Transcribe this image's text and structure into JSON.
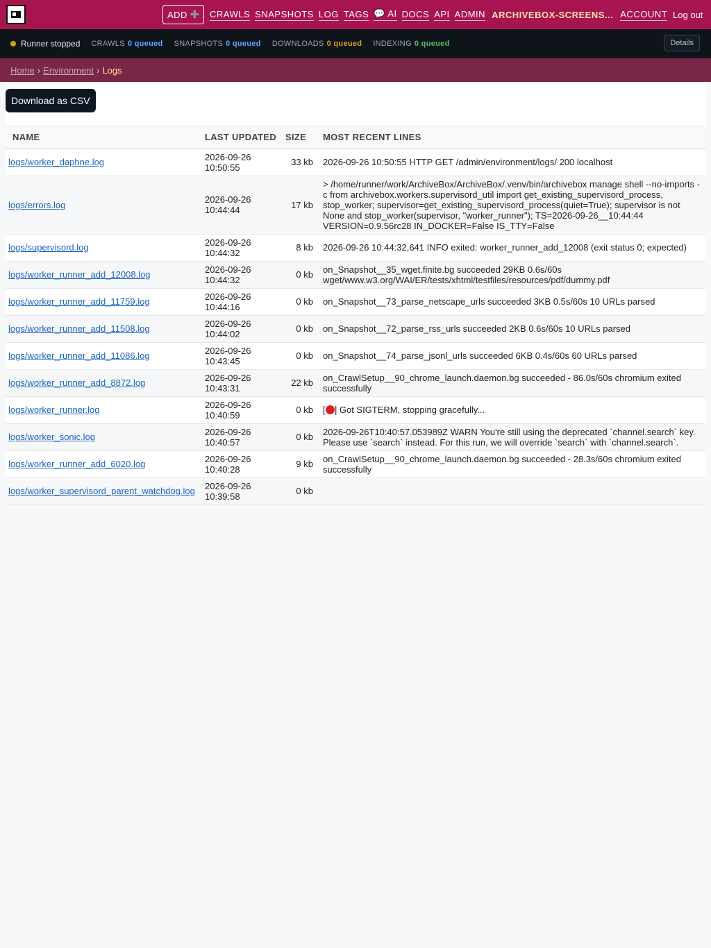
{
  "header": {
    "add_label": "ADD",
    "nav": [
      "CRAWLS",
      "SNAPSHOTS",
      "LOG",
      "TAGS",
      "💬 AI",
      "DOCS",
      "API",
      "ADMIN"
    ],
    "user": "ARCHIVEBOX-SCREENS...",
    "account": "ACCOUNT",
    "logout": "Log out"
  },
  "status": {
    "runner": "Runner stopped",
    "crawls_label": "CRAWLS",
    "crawls_q": "0 queued",
    "snapshots_label": "SNAPSHOTS",
    "snapshots_q": "0 queued",
    "downloads_label": "DOWNLOADS",
    "downloads_q": "0 queued",
    "indexing_label": "INDEXING",
    "indexing_q": "0 queued",
    "details": "Details"
  },
  "breadcrumb": {
    "home": "Home",
    "environment": "Environment",
    "sep": "›",
    "current": "Logs"
  },
  "main": {
    "csv_button": "Download as CSV",
    "columns": [
      "NAME",
      "LAST UPDATED",
      "SIZE",
      "MOST RECENT LINES"
    ],
    "rows": [
      {
        "name": "logs/worker_daphne.log",
        "date": "2026-09-26",
        "time": "10:50:55",
        "size": "33 kb",
        "lines": "2026-09-26 10:50:55 HTTP GET /admin/environment/logs/ 200 localhost"
      },
      {
        "name": "logs/errors.log",
        "date": "2026-09-26",
        "time": "10:44:44",
        "size": "17 kb",
        "lines": "> /home/runner/work/ArchiveBox/ArchiveBox/.venv/bin/archivebox manage shell --no-imports -c from archivebox.workers.supervisord_util import get_existing_supervisord_process, stop_worker; supervisor=get_existing_supervisord_process(quiet=True); supervisor is not None and stop_worker(supervisor, \"worker_runner\"); TS=2026-09-26__10:44:44 VERSION=0.9.56rc28 IN_DOCKER=False IS_TTY=False"
      },
      {
        "name": "logs/supervisord.log",
        "date": "2026-09-26",
        "time": "10:44:32",
        "size": "8 kb",
        "lines": "2026-09-26 10:44:32,641 INFO exited: worker_runner_add_12008 (exit status 0; expected)"
      },
      {
        "name": "logs/worker_runner_add_12008.log",
        "date": "2026-09-26",
        "time": "10:44:32",
        "size": "0 kb",
        "lines": "on_Snapshot__35_wget.finite.bg succeeded 29KB 0.6s/60s wget/www.w3.org/WAI/ER/tests/xhtml/testfiles/resources/pdf/dummy.pdf"
      },
      {
        "name": "logs/worker_runner_add_11759.log",
        "date": "2026-09-26",
        "time": "10:44:16",
        "size": "0 kb",
        "lines": "on_Snapshot__73_parse_netscape_urls succeeded 3KB 0.5s/60s 10 URLs parsed"
      },
      {
        "name": "logs/worker_runner_add_11508.log",
        "date": "2026-09-26",
        "time": "10:44:02",
        "size": "0 kb",
        "lines": "on_Snapshot__72_parse_rss_urls succeeded 2KB 0.6s/60s 10 URLs parsed"
      },
      {
        "name": "logs/worker_runner_add_11086.log",
        "date": "2026-09-26",
        "time": "10:43:45",
        "size": "0 kb",
        "lines": "on_Snapshot__74_parse_jsonl_urls succeeded 6KB 0.4s/60s 60 URLs parsed"
      },
      {
        "name": "logs/worker_runner_add_8872.log",
        "date": "2026-09-26",
        "time": "10:43:31",
        "size": "22 kb",
        "lines": "on_CrawlSetup__90_chrome_launch.daemon.bg succeeded - 86.0s/60s chromium exited successfully"
      },
      {
        "name": "logs/worker_runner.log",
        "date": "2026-09-26",
        "time": "10:40:59",
        "size": "0 kb",
        "lines_pre": "[",
        "lines_post": "] Got SIGTERM, stopping gracefully...",
        "lines": ""
      },
      {
        "name": "logs/worker_sonic.log",
        "date": "2026-09-26",
        "time": "10:40:57",
        "size": "0 kb",
        "lines": "2026-09-26T10:40:57.053989Z WARN You're still using the deprecated `channel.search` key. Please use `search` instead. For this run, we will override `search` with `channel.search`."
      },
      {
        "name": "logs/worker_runner_add_6020.log",
        "date": "2026-09-26",
        "time": "10:40:28",
        "size": "9 kb",
        "lines": "on_CrawlSetup__90_chrome_launch.daemon.bg succeeded - 28.3s/60s chromium exited successfully"
      },
      {
        "name": "logs/worker_supervisord_parent_watchdog.log",
        "date": "2026-09-26",
        "time": "10:39:58",
        "size": "0 kb",
        "lines": ""
      }
    ]
  },
  "colors": {
    "header": "#a8144f",
    "statusbar": "#0f141b",
    "breadcrumb": "#7a2646",
    "link": "#1a64c8"
  },
  "icons": {
    "stop": "stop-sign-icon",
    "logo": "archivebox-logo-icon",
    "add": "plus-icon"
  }
}
